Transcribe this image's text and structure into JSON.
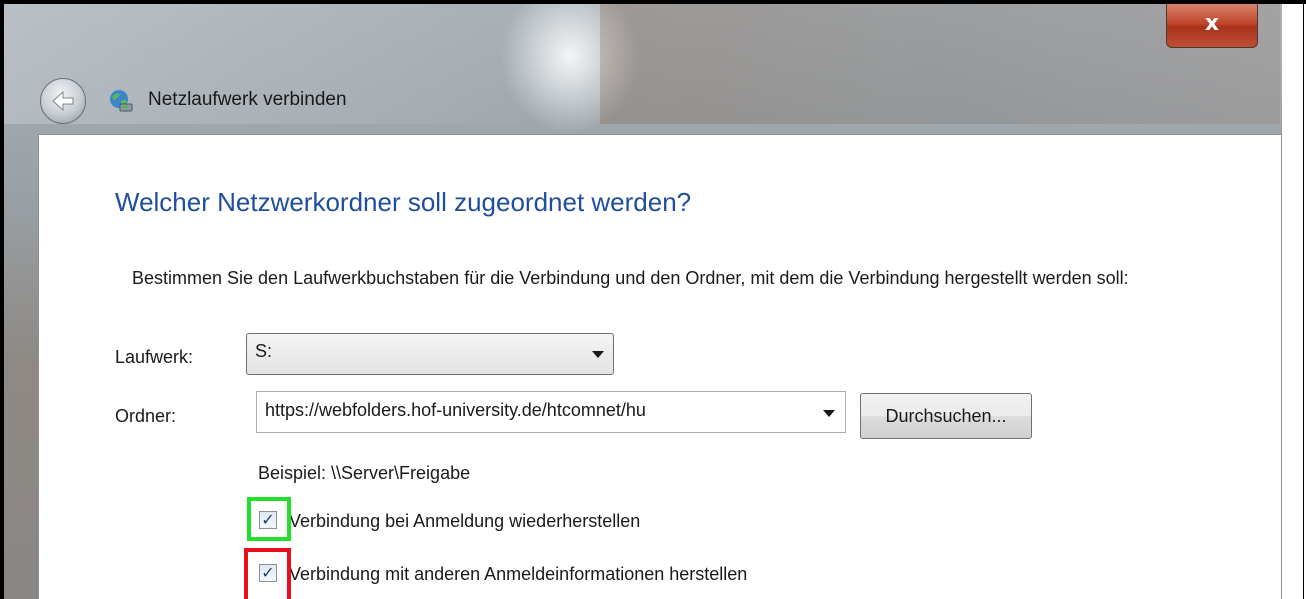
{
  "window": {
    "title": "Netzlaufwerk verbinden",
    "close_label": "x"
  },
  "heading": "Welcher Netzwerkordner soll zugeordnet werden?",
  "description": "Bestimmen Sie den Laufwerkbuchstaben für die Verbindung und den Ordner, mit dem die Verbindung hergestellt werden soll:",
  "drive": {
    "label": "Laufwerk:",
    "value": "S:"
  },
  "folder": {
    "label": "Ordner:",
    "value": "https://webfolders.hof-university.de/htcomnet/hu",
    "browse_label": "Durchsuchen..."
  },
  "example": "Beispiel: \\\\Server\\Freigabe",
  "options": [
    {
      "label": "Verbindung bei Anmeldung wiederherstellen",
      "checked": true,
      "highlight_color": "#22e02a"
    },
    {
      "label": "Verbindung mit anderen Anmeldeinformationen herstellen",
      "checked": true,
      "highlight_color": "#e8101b"
    }
  ],
  "icons": {
    "back": "back-arrow-icon",
    "network": "network-drive-icon",
    "close": "close-icon",
    "dropdown": "chevron-down-icon"
  },
  "colors": {
    "heading": "#1f4e9e",
    "close_button": "#c1452b"
  }
}
